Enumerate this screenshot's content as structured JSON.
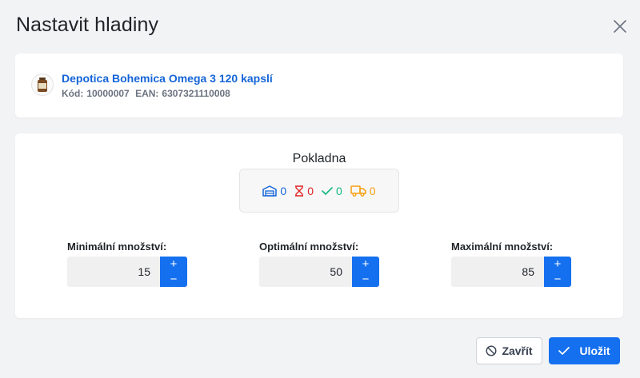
{
  "dialog": {
    "title": "Nastavit hladiny"
  },
  "product": {
    "name": "Depotica Bohemica Omega 3 120 kapslí",
    "code_label": "Kód:",
    "code_value": "10000007",
    "ean_label": "EAN:",
    "ean_value": "6307321110008"
  },
  "store": {
    "name": "Pokladna",
    "stock": [
      {
        "icon": "warehouse-icon",
        "value": "0",
        "color": "#1565d8"
      },
      {
        "icon": "hourglass-icon",
        "value": "0",
        "color": "#e02424"
      },
      {
        "icon": "check-icon",
        "value": "0",
        "color": "#10b981"
      },
      {
        "icon": "truck-icon",
        "value": "0",
        "color": "#f59e0b"
      }
    ]
  },
  "fields": {
    "min": {
      "label": "Minimální množství:",
      "value": "15"
    },
    "opt": {
      "label": "Optimální množství:",
      "value": "50"
    },
    "max": {
      "label": "Maximální množství:",
      "value": "85"
    },
    "plus": "+",
    "minus": "−"
  },
  "footer": {
    "close_label": "Zavřít",
    "save_label": "Uložit"
  },
  "colors": {
    "accent": "#1570ef",
    "link": "#1565d8"
  }
}
